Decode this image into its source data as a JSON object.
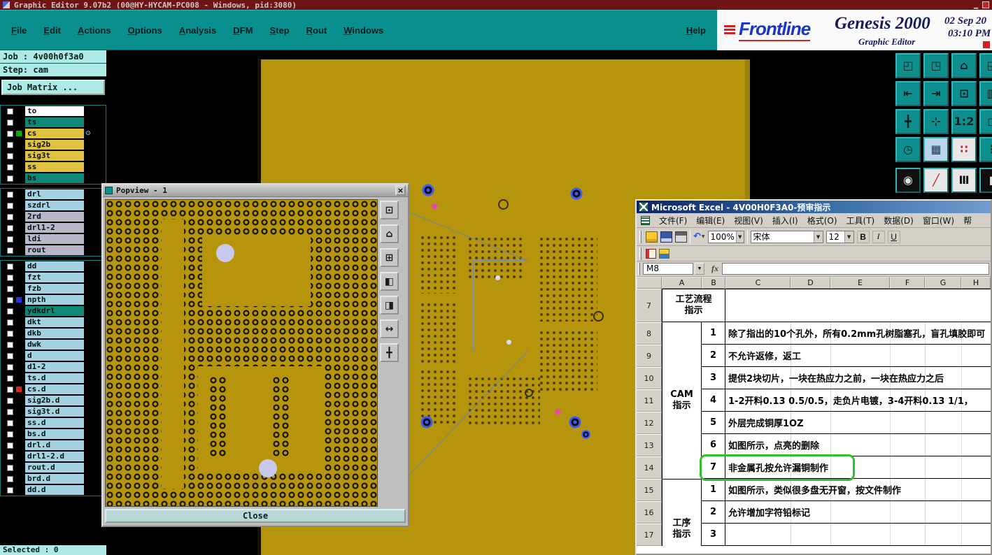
{
  "colors": {
    "titlebar": "#6e1414",
    "menubar-teal": "#0a8f8f",
    "panel-cyan": "#afe9e5",
    "olive": "#b6940c",
    "layer-yellow": "#e0c23e",
    "layer-teal": "#108878",
    "layer-blue": "#a5d2e2",
    "layer-gray": "#b7b7c9",
    "excel-title-blue": "#0a246a",
    "window-gray": "#d4d0c8",
    "highlight-green": "#2ec22e",
    "donut-blue": "#3b5cf0",
    "magenta": "#e646b4",
    "lavender": "#c9c9ee"
  },
  "titlebar": {
    "title": "Graphic Editor 9.07b2 (00@HY-HYCAM-PC008 - Windows, pid:3080)",
    "minimize": "▁"
  },
  "menubar": {
    "items": [
      "File",
      "Edit",
      "Actions",
      "Options",
      "Analysis",
      "DFM",
      "Step",
      "Rout",
      "Windows"
    ],
    "help": "Help"
  },
  "brand": {
    "logo": "Frontline",
    "product": "Genesis 2000",
    "date": "02 Sep 20",
    "time": "03:10 PM",
    "subtitle": "Graphic Editor"
  },
  "job_panel": {
    "job": "Job : 4v00h0f3a0",
    "step": "Step: cam",
    "matrix_button": "Job Matrix ...",
    "selected": "Selected : 0"
  },
  "layers": {
    "group1": [
      {
        "name": "to",
        "color": "#ffffff"
      },
      {
        "name": "ts",
        "color": "#108878"
      },
      {
        "name": "cs",
        "color": "#e0c23e",
        "ind": "#00b400",
        "marker": "⊙"
      },
      {
        "name": "sig2b",
        "color": "#e0c23e"
      },
      {
        "name": "sig3t",
        "color": "#e0c23e"
      },
      {
        "name": "ss",
        "color": "#e0c23e"
      },
      {
        "name": "bs",
        "color": "#108878"
      }
    ],
    "group2": [
      {
        "name": "drl",
        "color": "#a5d2e2"
      },
      {
        "name": "szdrl",
        "color": "#a5d2e2"
      },
      {
        "name": "2rd",
        "color": "#b7b7c9"
      },
      {
        "name": "drl1-2",
        "color": "#b7b7c9"
      },
      {
        "name": "ldi",
        "color": "#b7b7c9"
      },
      {
        "name": "rout",
        "color": "#b7b7c9"
      }
    ],
    "group3": [
      {
        "name": "dd",
        "color": "#a5d2e2"
      },
      {
        "name": "fzt",
        "color": "#a5d2e2"
      },
      {
        "name": "fzb",
        "color": "#a5d2e2"
      },
      {
        "name": "npth",
        "color": "#a5d2e2",
        "ind": "#2233dd"
      },
      {
        "name": "ydkdrl",
        "color": "#108878"
      },
      {
        "name": "dkt",
        "color": "#a5d2e2"
      },
      {
        "name": "dkb",
        "color": "#a5d2e2"
      },
      {
        "name": "dwk",
        "color": "#a5d2e2"
      },
      {
        "name": "d",
        "color": "#a5d2e2"
      },
      {
        "name": "d1-2",
        "color": "#a5d2e2"
      },
      {
        "name": "ts.d",
        "color": "#a5d2e2"
      },
      {
        "name": "cs.d",
        "color": "#a5d2e2",
        "ind": "#dd2222"
      },
      {
        "name": "sig2b.d",
        "color": "#a5d2e2"
      },
      {
        "name": "sig3t.d",
        "color": "#a5d2e2"
      },
      {
        "name": "ss.d",
        "color": "#a5d2e2"
      },
      {
        "name": "bs.d",
        "color": "#a5d2e2"
      },
      {
        "name": "drl.d",
        "color": "#a5d2e2"
      },
      {
        "name": "drl1-2.d",
        "color": "#a5d2e2"
      },
      {
        "name": "rout.d",
        "color": "#a5d2e2"
      },
      {
        "name": "brd.d",
        "color": "#a5d2e2"
      },
      {
        "name": "dd.d",
        "color": "#a5d2e2"
      }
    ]
  },
  "right_toolbar": {
    "main": [
      {
        "glyph": "◰",
        "name": "view-top-left",
        "bg": "#0d8f8f",
        "fg": "#06201e"
      },
      {
        "glyph": "◳",
        "name": "view-top-right",
        "bg": "#0d8f8f",
        "fg": "#06201e"
      },
      {
        "glyph": "⌂",
        "name": "home-view",
        "bg": "#0d8f8f",
        "fg": "#06201e"
      },
      {
        "glyph": "◱",
        "name": "view-bottom",
        "bg": "#0d8f8f",
        "fg": "#06201e"
      },
      {
        "glyph": "⇤",
        "name": "pan-left",
        "bg": "#0d8f8f",
        "fg": "#06201e"
      },
      {
        "glyph": "⇥",
        "name": "pan-right",
        "bg": "#0d8f8f",
        "fg": "#06201e"
      },
      {
        "glyph": "⊡",
        "name": "zoom-window",
        "bg": "#0d8f8f",
        "fg": "#06201e"
      },
      {
        "glyph": "▥",
        "name": "layer-view",
        "bg": "#0d8f8f",
        "fg": "#06201e"
      },
      {
        "glyph": "╋",
        "name": "crosshair",
        "bg": "#0d8f8f",
        "fg": "#06201e"
      },
      {
        "glyph": "⊹",
        "name": "pan-center",
        "bg": "#0d8f8f",
        "fg": "#06201e"
      },
      {
        "glyph": "1:2",
        "name": "zoom-1-2",
        "bg": "#0d8f8f",
        "fg": "#06201e"
      },
      {
        "glyph": "◻",
        "name": "frame-view",
        "bg": "#0d8f8f",
        "fg": "#06201e"
      },
      {
        "glyph": "◷",
        "name": "clock-tool",
        "bg": "#0d8f8f",
        "fg": "#06201e"
      },
      {
        "glyph": "▦",
        "name": "grid-toggle",
        "bg": "#b9d6ec",
        "fg": "#223355"
      },
      {
        "glyph": "∷",
        "name": "snap-points",
        "bg": "#e8e8e8",
        "fg": "#cc2222"
      },
      {
        "glyph": "⋮",
        "name": "more-tools",
        "bg": "#0d8f8f",
        "fg": "#06201e"
      }
    ],
    "extra": [
      {
        "glyph": "◉",
        "name": "highlight-tool",
        "bg": "#101010",
        "fg": "#e0e0e0"
      },
      {
        "glyph": "╱",
        "name": "measure-tool",
        "bg": "#e8e8e8",
        "fg": "#cc2222"
      },
      {
        "glyph": "Ⅲ",
        "name": "ruler-tool",
        "bg": "#e8e8e8",
        "fg": "#101010"
      },
      {
        "glyph": "▮",
        "name": "cursor-tool",
        "bg": "#101010",
        "fg": "#e0e0e0"
      }
    ]
  },
  "popview": {
    "title": "Popview - 1",
    "close_x": "×",
    "close_button": "Close",
    "buttons": [
      {
        "glyph": "⊡",
        "name": "zoom-window"
      },
      {
        "glyph": "⌂",
        "name": "home-view"
      },
      {
        "glyph": "⊞",
        "name": "zoom-in"
      },
      {
        "glyph": "◧",
        "name": "pan-left-half"
      },
      {
        "glyph": "◨",
        "name": "pan-right-half"
      },
      {
        "glyph": "↔",
        "name": "fit-width"
      },
      {
        "glyph": "╋",
        "name": "crosshair"
      }
    ]
  },
  "excel": {
    "title": "Microsoft Excel - 4V00H0F3A0-预审指示",
    "menus": [
      "文件(F)",
      "编辑(E)",
      "视图(V)",
      "插入(I)",
      "格式(O)",
      "工具(T)",
      "数据(D)",
      "窗口(W)",
      "帮"
    ],
    "toolbar": {
      "zoom": "100%",
      "font": "宋体",
      "size": "12",
      "bold": "B",
      "italic": "I",
      "underline": "U",
      "undo": "↶",
      "dropdown": "▼"
    },
    "name_box": "M8",
    "fx": "fx",
    "columns": [
      "A",
      "B",
      "C",
      "D",
      "E",
      "F",
      "G",
      "H"
    ],
    "row7": {
      "num": "7",
      "line1": "工艺流程",
      "line2": "指示"
    },
    "cam_label1": "CAM",
    "cam_label2": "指示",
    "gongxu_label1": "工序",
    "gongxu_label2": "指示",
    "cam_rows": [
      {
        "num": "8",
        "no": "1",
        "text": "除了指出的10个孔外，所有0.2mm孔树脂塞孔，盲孔填胶即可"
      },
      {
        "num": "9",
        "no": "2",
        "text": "不允许返修，返工"
      },
      {
        "num": "10",
        "no": "3",
        "text": "提供2块切片，一块在热应力之前，一块在热应力之后"
      },
      {
        "num": "11",
        "no": "4",
        "text": "1-2开料0.13 0.5/0.5，走负片电镀，3-4开料0.13 1/1，"
      },
      {
        "num": "12",
        "no": "5",
        "text": "外层完成铜厚1OZ"
      },
      {
        "num": "13",
        "no": "6",
        "text": "如图所示，点亮的删除"
      },
      {
        "num": "14",
        "no": "7",
        "text": "非金属孔按允许漏铜制作"
      }
    ],
    "gongxu_rows": [
      {
        "num": "15",
        "no": "1",
        "text": "如图所示，类似很多盘无开窗，按文件制作"
      },
      {
        "num": "16",
        "no": "2",
        "text": "允许增加字符铅标记"
      },
      {
        "num": "17",
        "no": "3",
        "text": ""
      }
    ]
  }
}
